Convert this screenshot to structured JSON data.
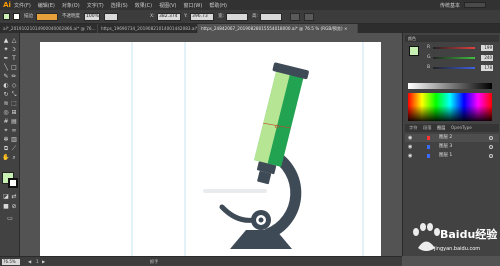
{
  "menubar": {
    "logo": "Ai",
    "items": [
      "文件(F)",
      "编辑(E)",
      "对象(O)",
      "文字(T)",
      "选择(S)",
      "效果(C)",
      "视图(V)",
      "窗口(W)",
      "帮助(H)"
    ],
    "workspace": "传统基本"
  },
  "controlbar": {
    "fill_color": "#c7f0b2",
    "stroke_label": "描边",
    "stroke_value": "",
    "opacity_label": "不透明度",
    "opacity_value": "100%",
    "x_label": "X:",
    "x_value": "382.374",
    "y_label": "Y:",
    "y_value": "396.73",
    "w_label": "宽:",
    "w_value": "",
    "h_label": "高:",
    "h_value": ""
  },
  "tabs": [
    {
      "label": "ai*_20191021014900040002866.ai* @ 76... ×",
      "active": false
    },
    {
      "label": "https_19690734_20190821014001442083.ai* ×",
      "active": false
    },
    {
      "label": "https_24842067_20190828015554018000.ai* @ 76.5 % (RGB/预览) ×",
      "active": true
    }
  ],
  "color_panel": {
    "preview_color": "#c7f0b2",
    "sliders": [
      {
        "label": "R",
        "value": "199",
        "color": "#e04040"
      },
      {
        "label": "G",
        "value": "240",
        "color": "#40c040"
      },
      {
        "label": "B",
        "value": "178",
        "color": "#4060e0"
      }
    ]
  },
  "layers_panel": {
    "tabs": [
      "字符",
      "段落",
      "图层",
      "OpenType"
    ],
    "active_tab": "图层",
    "layers": [
      {
        "name": "图层 2",
        "color": "#ff3333"
      },
      {
        "name": "图层 3",
        "color": "#3a6bff"
      },
      {
        "name": "图层 1",
        "color": "#3a6bff"
      }
    ]
  },
  "statusbar": {
    "zoom": "76.5%",
    "page": "1",
    "tool": "抓手"
  },
  "watermark": {
    "text": "Baidu经验",
    "url": "jingyan.baidu.com"
  },
  "artwork": {
    "tube_light": "#b6e694",
    "tube_dark": "#22a352",
    "metal": "#3f4a57",
    "stage": "#e9ecef"
  }
}
